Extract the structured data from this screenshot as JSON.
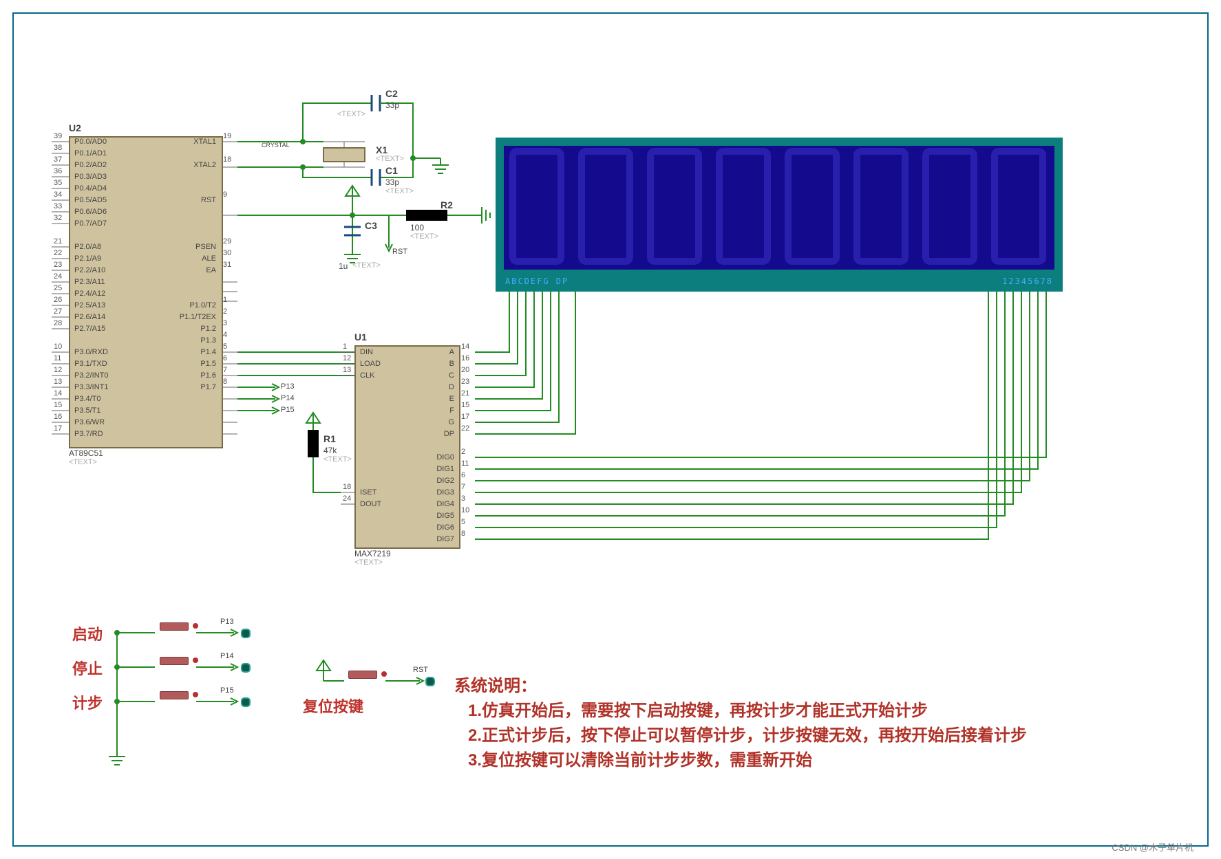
{
  "u2": {
    "ref": "U2",
    "part": "AT89C51",
    "text_placeholder": "<TEXT>",
    "left_pins": [
      {
        "num": "39",
        "name": "P0.0/AD0"
      },
      {
        "num": "38",
        "name": "P0.1/AD1"
      },
      {
        "num": "37",
        "name": "P0.2/AD2"
      },
      {
        "num": "36",
        "name": "P0.3/AD3"
      },
      {
        "num": "35",
        "name": "P0.4/AD4"
      },
      {
        "num": "34",
        "name": "P0.5/AD5"
      },
      {
        "num": "33",
        "name": "P0.6/AD6"
      },
      {
        "num": "32",
        "name": "P0.7/AD7"
      },
      {
        "num": "",
        "name": ""
      },
      {
        "num": "21",
        "name": "P2.0/A8"
      },
      {
        "num": "22",
        "name": "P2.1/A9"
      },
      {
        "num": "23",
        "name": "P2.2/A10"
      },
      {
        "num": "24",
        "name": "P2.3/A11"
      },
      {
        "num": "25",
        "name": "P2.4/A12"
      },
      {
        "num": "26",
        "name": "P2.5/A13"
      },
      {
        "num": "27",
        "name": "P2.6/A14"
      },
      {
        "num": "28",
        "name": "P2.7/A15"
      },
      {
        "num": "",
        "name": ""
      },
      {
        "num": "10",
        "name": "P3.0/RXD"
      },
      {
        "num": "11",
        "name": "P3.1/TXD"
      },
      {
        "num": "12",
        "name": "P3.2/INT0"
      },
      {
        "num": "13",
        "name": "P3.3/INT1"
      },
      {
        "num": "14",
        "name": "P3.4/T0"
      },
      {
        "num": "15",
        "name": "P3.5/T1"
      },
      {
        "num": "16",
        "name": "P3.6/WR"
      },
      {
        "num": "17",
        "name": "P3.7/RD"
      }
    ],
    "right_pins": [
      {
        "num": "19",
        "name": "XTAL1"
      },
      {
        "num": "",
        "name": ""
      },
      {
        "num": "18",
        "name": "XTAL2"
      },
      {
        "num": "",
        "name": ""
      },
      {
        "num": "",
        "name": ""
      },
      {
        "num": "9",
        "name": "RST"
      },
      {
        "num": "",
        "name": ""
      },
      {
        "num": "",
        "name": ""
      },
      {
        "num": "",
        "name": ""
      },
      {
        "num": "29",
        "name": "PSEN"
      },
      {
        "num": "30",
        "name": "ALE"
      },
      {
        "num": "31",
        "name": "EA"
      },
      {
        "num": "",
        "name": ""
      },
      {
        "num": "",
        "name": ""
      },
      {
        "num": "1",
        "name": "P1.0/T2"
      },
      {
        "num": "2",
        "name": "P1.1/T2EX"
      },
      {
        "num": "3",
        "name": "P1.2"
      },
      {
        "num": "4",
        "name": "P1.3"
      },
      {
        "num": "5",
        "name": "P1.4"
      },
      {
        "num": "6",
        "name": "P1.5"
      },
      {
        "num": "7",
        "name": "P1.6"
      },
      {
        "num": "8",
        "name": "P1.7"
      }
    ]
  },
  "u1": {
    "ref": "U1",
    "part": "MAX7219",
    "text_placeholder": "<TEXT>",
    "left_pins": [
      {
        "num": "1",
        "name": "DIN"
      },
      {
        "num": "12",
        "name": "LOAD"
      },
      {
        "num": "13",
        "name": "CLK"
      },
      {
        "num": "",
        "name": ""
      },
      {
        "num": "",
        "name": ""
      },
      {
        "num": "",
        "name": ""
      },
      {
        "num": "",
        "name": ""
      },
      {
        "num": "",
        "name": ""
      },
      {
        "num": "",
        "name": ""
      },
      {
        "num": "",
        "name": ""
      },
      {
        "num": "",
        "name": ""
      },
      {
        "num": "",
        "name": ""
      },
      {
        "num": "18",
        "name": "ISET"
      },
      {
        "num": "24",
        "name": "DOUT"
      }
    ],
    "right_pins": [
      {
        "num": "14",
        "name": "A"
      },
      {
        "num": "16",
        "name": "B"
      },
      {
        "num": "20",
        "name": "C"
      },
      {
        "num": "23",
        "name": "D"
      },
      {
        "num": "21",
        "name": "E"
      },
      {
        "num": "15",
        "name": "F"
      },
      {
        "num": "17",
        "name": "G"
      },
      {
        "num": "22",
        "name": "DP"
      },
      {
        "num": "",
        "name": ""
      },
      {
        "num": "2",
        "name": "DIG0"
      },
      {
        "num": "11",
        "name": "DIG1"
      },
      {
        "num": "6",
        "name": "DIG2"
      },
      {
        "num": "7",
        "name": "DIG3"
      },
      {
        "num": "3",
        "name": "DIG4"
      },
      {
        "num": "10",
        "name": "DIG5"
      },
      {
        "num": "5",
        "name": "DIG6"
      },
      {
        "num": "8",
        "name": "DIG7"
      }
    ]
  },
  "components": {
    "c1": {
      "ref": "C1",
      "val": "33p",
      "txt": "<TEXT>"
    },
    "c2": {
      "ref": "C2",
      "val": "33p",
      "txt": "<TEXT>"
    },
    "c3": {
      "ref": "C3",
      "val": "1u",
      "txt": "<TEXT>"
    },
    "x1": {
      "ref": "X1",
      "val": "CRYSTAL",
      "txt": "<TEXT>"
    },
    "r1": {
      "ref": "R1",
      "val": "47k",
      "txt": "<TEXT>"
    },
    "r2": {
      "ref": "R2",
      "val": "100",
      "txt": "<TEXT>"
    }
  },
  "net_labels": {
    "p13": "P13",
    "p14": "P14",
    "p15": "P15",
    "rst": "RST"
  },
  "display": {
    "seg_row": "ABCDEFG DP",
    "dig_row": "12345678"
  },
  "buttons": {
    "start": "启动",
    "stop": "停止",
    "step": "计步",
    "reset": "复位按键",
    "p13": "P13",
    "p14": "P14",
    "p15": "P15",
    "rst": "RST"
  },
  "notes": {
    "title": "系统说明：",
    "line1": "1.仿真开始后，需要按下启动按键，再按计步才能正式开始计步",
    "line2": "2.正式计步后，按下停止可以暂停计步，计步按键无效，再按开始后接着计步",
    "line3": "3.复位按键可以清除当前计步步数，需重新开始"
  },
  "watermark": "CSDN @木子单片机"
}
